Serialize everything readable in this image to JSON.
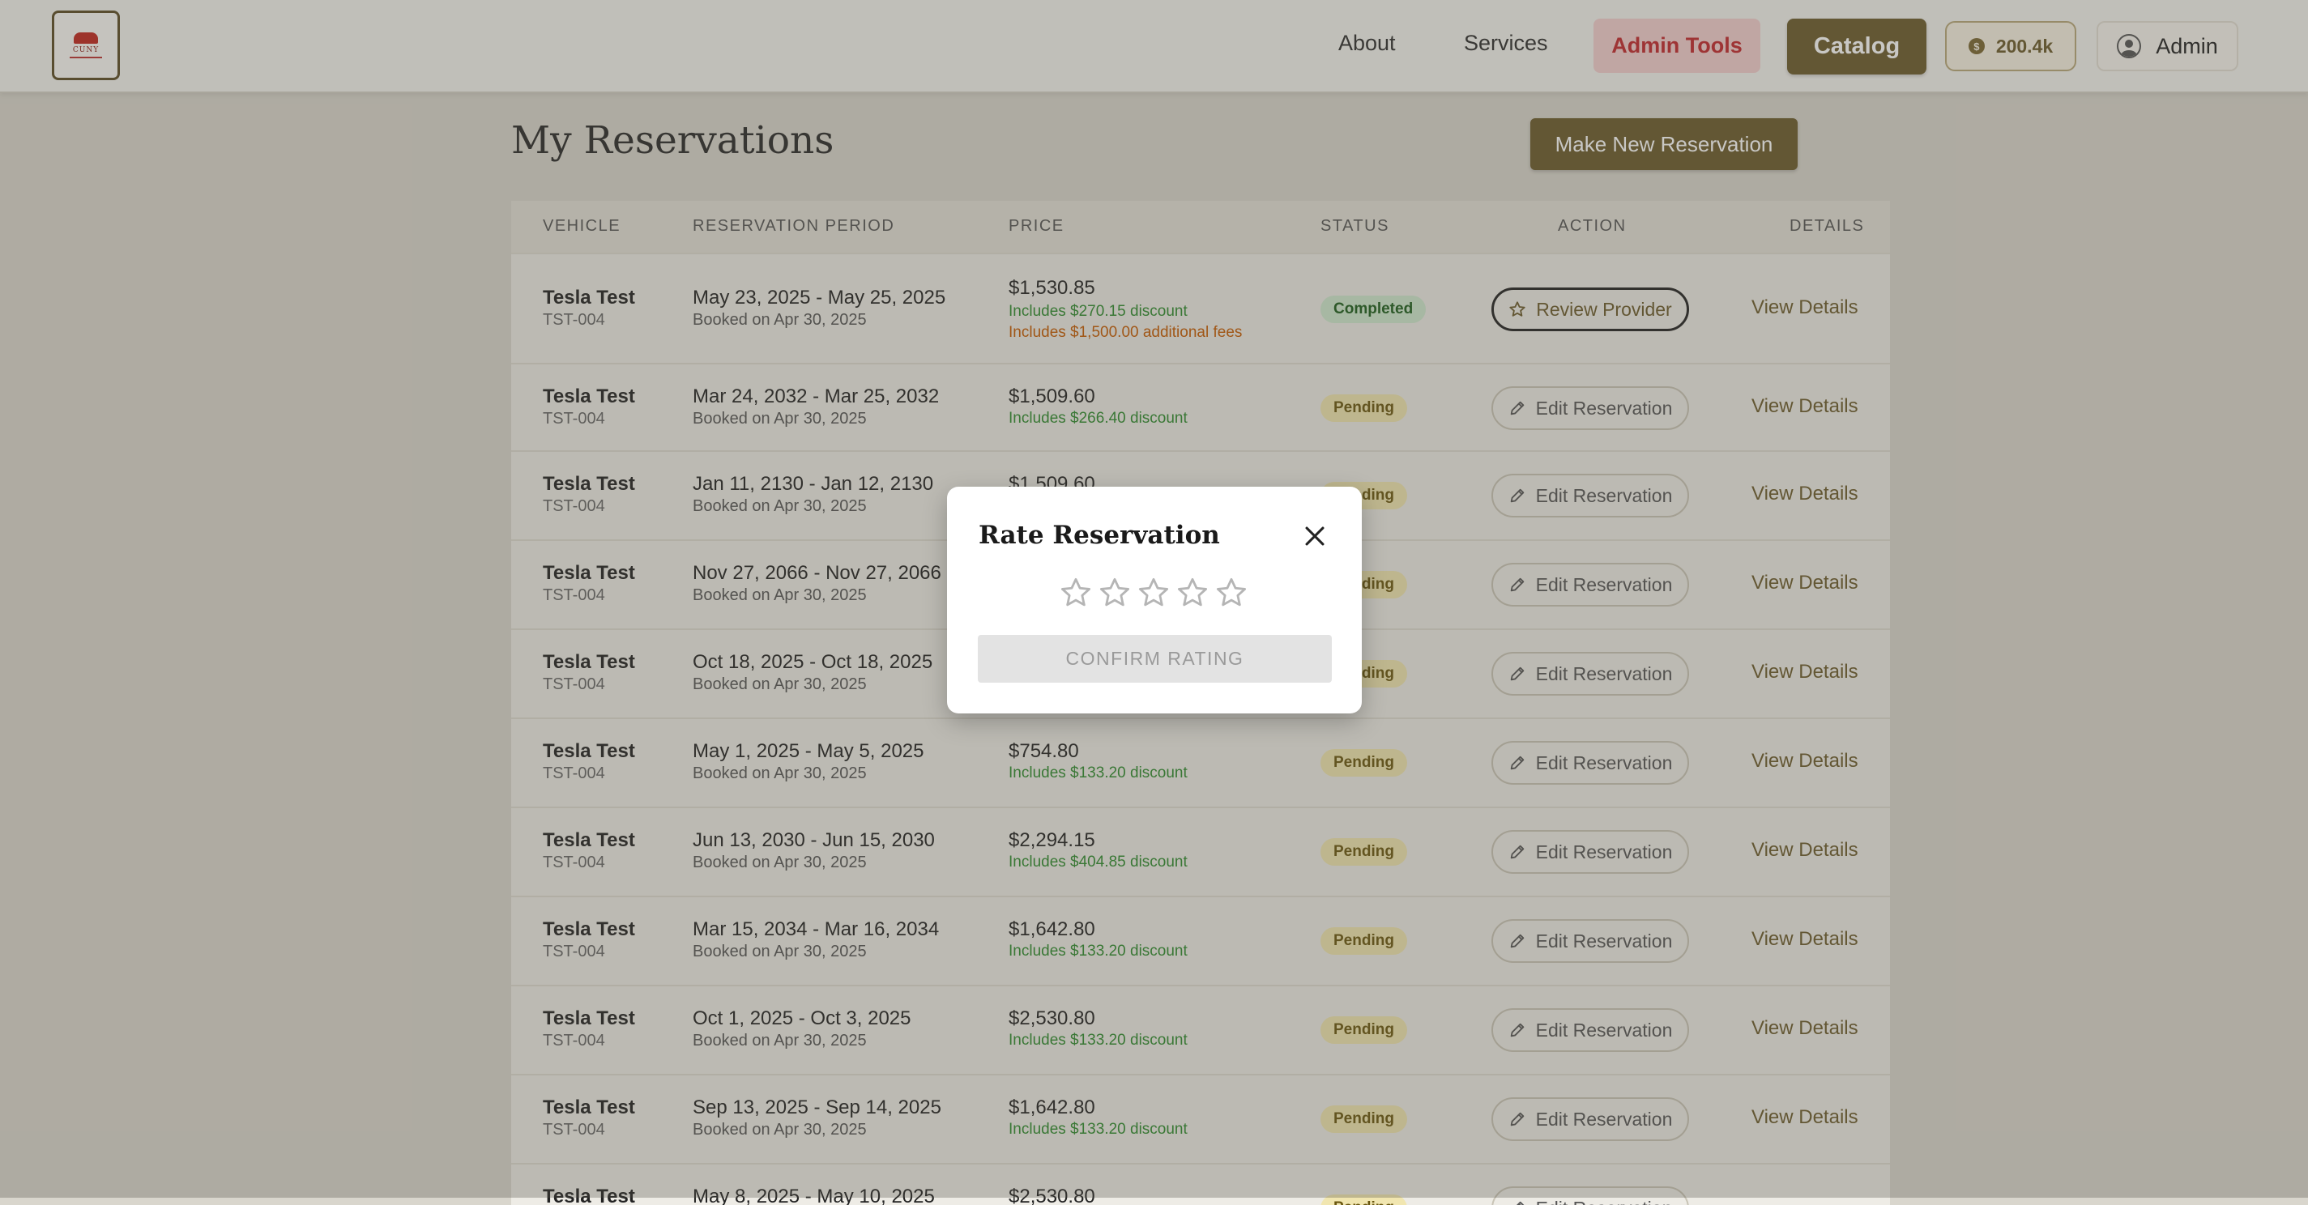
{
  "nav": {
    "logo_text": "CUNY",
    "about": "About",
    "services": "Services",
    "admin_tools": "Admin Tools",
    "catalog": "Catalog",
    "points": "200.4k",
    "user": "Admin"
  },
  "page": {
    "title": "My Reservations",
    "new_button": "Make New Reservation"
  },
  "table": {
    "headers": [
      "VEHICLE",
      "RESERVATION PERIOD",
      "PRICE",
      "STATUS",
      "ACTION",
      "DETAILS"
    ],
    "rows": [
      {
        "vehicle": "Tesla Test",
        "code": "TST-004",
        "period": "May 23, 2025 - May 25, 2025",
        "booked": "Booked on Apr 30, 2025",
        "price": "$1,530.85",
        "discount": "Includes $270.15 discount",
        "fees": "Includes $1,500.00 additional fees",
        "status": "Completed",
        "action": "Review Provider",
        "details": "View Details"
      },
      {
        "vehicle": "Tesla Test",
        "code": "TST-004",
        "period": "Mar 24, 2032 - Mar 25, 2032",
        "booked": "Booked on Apr 30, 2025",
        "price": "$1,509.60",
        "discount": "Includes $266.40 discount",
        "status": "Pending",
        "action": "Edit Reservation",
        "details": "View Details"
      },
      {
        "vehicle": "Tesla Test",
        "code": "TST-004",
        "period": "Jan 11, 2130 - Jan 12, 2130",
        "booked": "Booked on Apr 30, 2025",
        "price": "$1,509.60",
        "discount": "",
        "status": "Pending",
        "action": "Edit Reservation",
        "details": "View Details"
      },
      {
        "vehicle": "Tesla Test",
        "code": "TST-004",
        "period": "Nov 27, 2066 - Nov 27, 2066",
        "booked": "Booked on Apr 30, 2025",
        "price": "",
        "discount": "",
        "status": "Pending",
        "action": "Edit Reservation",
        "details": "View Details"
      },
      {
        "vehicle": "Tesla Test",
        "code": "TST-004",
        "period": "Oct 18, 2025 - Oct 18, 2025",
        "booked": "Booked on Apr 30, 2025",
        "price": "",
        "discount": "",
        "status": "Pending",
        "action": "Edit Reservation",
        "details": "View Details"
      },
      {
        "vehicle": "Tesla Test",
        "code": "TST-004",
        "period": "May 1, 2025 - May 5, 2025",
        "booked": "Booked on Apr 30, 2025",
        "price": "$754.80",
        "discount": "Includes $133.20 discount",
        "status": "Pending",
        "action": "Edit Reservation",
        "details": "View Details"
      },
      {
        "vehicle": "Tesla Test",
        "code": "TST-004",
        "period": "Jun 13, 2030 - Jun 15, 2030",
        "booked": "Booked on Apr 30, 2025",
        "price": "$2,294.15",
        "discount": "Includes $404.85 discount",
        "status": "Pending",
        "action": "Edit Reservation",
        "details": "View Details"
      },
      {
        "vehicle": "Tesla Test",
        "code": "TST-004",
        "period": "Mar 15, 2034 - Mar 16, 2034",
        "booked": "Booked on Apr 30, 2025",
        "price": "$1,642.80",
        "discount": "Includes $133.20 discount",
        "status": "Pending",
        "action": "Edit Reservation",
        "details": "View Details"
      },
      {
        "vehicle": "Tesla Test",
        "code": "TST-004",
        "period": "Oct 1, 2025 - Oct 3, 2025",
        "booked": "Booked on Apr 30, 2025",
        "price": "$2,530.80",
        "discount": "Includes $133.20 discount",
        "status": "Pending",
        "action": "Edit Reservation",
        "details": "View Details"
      },
      {
        "vehicle": "Tesla Test",
        "code": "TST-004",
        "period": "Sep 13, 2025 - Sep 14, 2025",
        "booked": "Booked on Apr 30, 2025",
        "price": "$1,642.80",
        "discount": "Includes $133.20 discount",
        "status": "Pending",
        "action": "Edit Reservation",
        "details": "View Details"
      },
      {
        "vehicle": "Tesla Test",
        "code": "",
        "period": "May 8, 2025 - May 10, 2025",
        "booked": "",
        "price": "$2,530.80",
        "discount": "",
        "status": "Pending",
        "action": "Edit Reservation",
        "details": ""
      }
    ]
  },
  "modal": {
    "title": "Rate Reservation",
    "stars_selected": 0,
    "stars_total": 5,
    "confirm": "CONFIRM RATING"
  },
  "colors": {
    "brand": "#6b5a2b",
    "admin_text": "#c1272d",
    "discount": "#2e8b2e",
    "fees": "#c55a00",
    "pending_bg": "#f1e6b0",
    "completed_bg": "#cfe9cf"
  }
}
